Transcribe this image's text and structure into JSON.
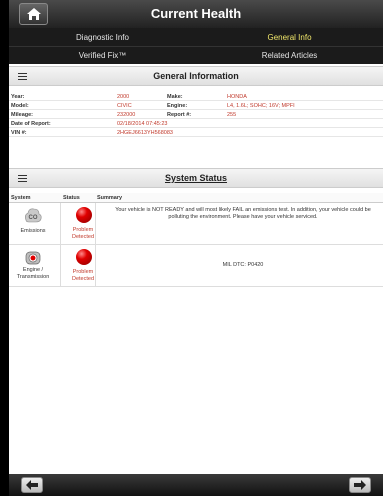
{
  "header": {
    "title": "Current Health",
    "home_icon": "home-icon"
  },
  "nav": {
    "items": [
      {
        "label": "Diagnostic Info"
      },
      {
        "label": "General Info"
      },
      {
        "label": "Verified Fix™"
      },
      {
        "label": "Related Articles"
      }
    ],
    "active_color": "#f0e66a"
  },
  "general": {
    "title": "General Information",
    "year_label": "Year:",
    "year": "2000",
    "make_label": "Make:",
    "make": "HONDA",
    "model_label": "Model:",
    "model": "CIVIC",
    "engine_label": "Engine:",
    "engine": "L4, 1.6L; SOHC; 16V; MPFI",
    "mileage_label": "Mileage:",
    "mileage": "232000",
    "report_label": "Report #:",
    "report": "255",
    "date_label": "Date of Report:",
    "date": "02/18/2014 07:45:23",
    "vin_label": "VIN #:",
    "vin": "2HGEJ6613YH568083"
  },
  "status": {
    "title": "System Status",
    "col_system": "System",
    "col_status": "Status",
    "col_summary": "Summary",
    "rows": [
      {
        "system": "Emissions",
        "icon": "co2-icon",
        "status": "Problem Detected",
        "summary": "Your vehicle is NOT READY and will most likely FAIL an emissions test. In addition, your vehicle could be polluting the environment. Please have your vehicle serviced."
      },
      {
        "system": "Engine / Transmission",
        "icon": "engine-icon",
        "status": "Problem Detected",
        "summary": "MIL DTC: P0420"
      }
    ]
  },
  "colors": {
    "value": "#c0392b",
    "problem": "#c0392b"
  },
  "bottom": {
    "back_icon": "arrow-left-icon",
    "forward_icon": "arrow-right-icon"
  }
}
